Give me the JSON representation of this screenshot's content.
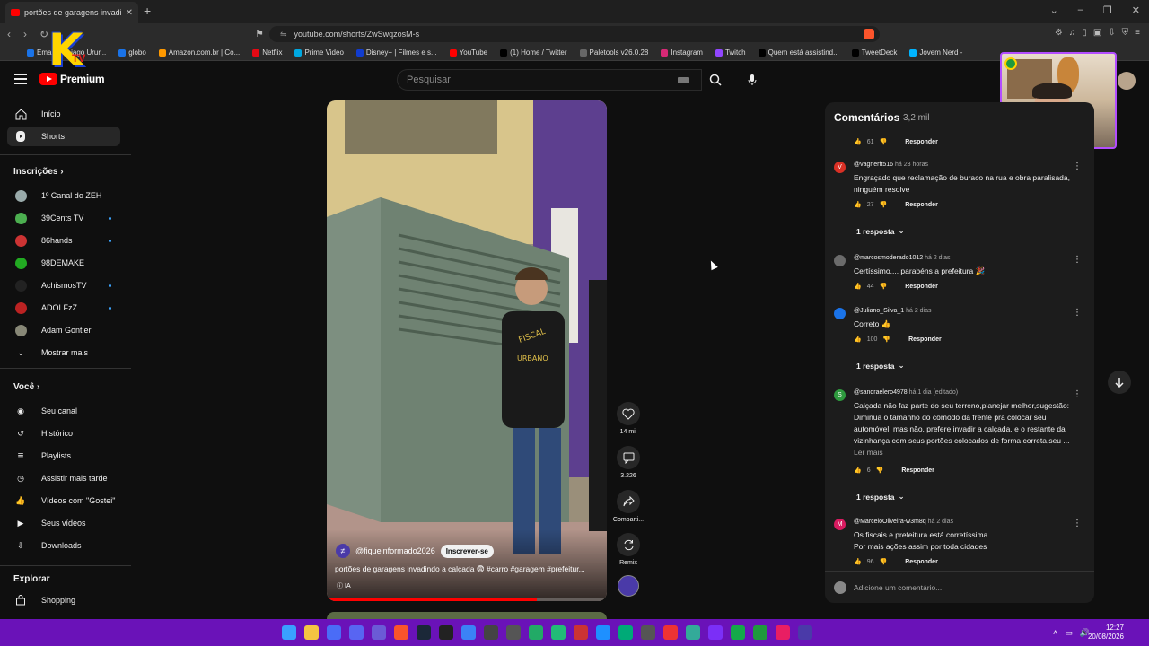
{
  "browser": {
    "tab_title": "portões de garagens invadind",
    "url": "youtube.com/shorts/ZwSwqzosM-s",
    "bookmarks": [
      {
        "label": "Email – Thiago Urur...",
        "color": "#1a73e8"
      },
      {
        "label": "globo",
        "color": "#1a73e8"
      },
      {
        "label": "Amazon.com.br | Co...",
        "color": "#ff9900"
      },
      {
        "label": "Netflix",
        "color": "#e50914"
      },
      {
        "label": "Prime Video",
        "color": "#00a8e1"
      },
      {
        "label": "Disney+ | Filmes e s...",
        "color": "#113ccf"
      },
      {
        "label": "YouTube",
        "color": "#ff0000"
      },
      {
        "label": "(1) Home / Twitter",
        "color": "#000000"
      },
      {
        "label": "Paletools v26.0.28",
        "color": "#666666"
      },
      {
        "label": "Instagram",
        "color": "#d62976"
      },
      {
        "label": "Twitch",
        "color": "#9146ff"
      },
      {
        "label": "Quem está assistind...",
        "color": "#000000"
      },
      {
        "label": "TweetDeck",
        "color": "#000000"
      },
      {
        "label": "Jovem Nerd -",
        "color": "#00b4ff"
      }
    ]
  },
  "header": {
    "logo_text": "Premium",
    "search_placeholder": "Pesquisar"
  },
  "sidebar": {
    "main": [
      {
        "label": "Início",
        "icon": "home-icon"
      },
      {
        "label": "Shorts",
        "icon": "shorts-icon"
      }
    ],
    "subscriptions_title": "Inscrições",
    "subscriptions": [
      {
        "label": "1º Canal do ZEH",
        "color": "#9aa",
        "live": false
      },
      {
        "label": "39Cents TV",
        "color": "#4caf50",
        "live": true
      },
      {
        "label": "86hands",
        "color": "#c33",
        "live": true
      },
      {
        "label": "98DEMAKE",
        "color": "#2a2",
        "live": false
      },
      {
        "label": "AchismosTV",
        "color": "#222",
        "live": true
      },
      {
        "label": "ADOLFzZ",
        "color": "#b22",
        "live": true
      },
      {
        "label": "Adam Gontier",
        "color": "#887",
        "live": false
      }
    ],
    "show_more": "Mostrar mais",
    "you_title": "Você",
    "you_items": [
      {
        "label": "Seu canal",
        "icon": "channel-icon"
      },
      {
        "label": "Histórico",
        "icon": "history-icon"
      },
      {
        "label": "Playlists",
        "icon": "playlist-icon"
      },
      {
        "label": "Assistir mais tarde",
        "icon": "watch-later-icon"
      },
      {
        "label": "Vídeos com \"Gostei\"",
        "icon": "like-icon"
      },
      {
        "label": "Seus vídeos",
        "icon": "your-videos-icon"
      },
      {
        "label": "Downloads",
        "icon": "download-icon"
      }
    ],
    "explore_title": "Explorar",
    "explore_items": [
      {
        "label": "Shopping",
        "icon": "shopping-icon"
      }
    ]
  },
  "short": {
    "channel": "@fiqueinformado2026",
    "subscribe_label": "Inscrever-se",
    "caption": "portões de garagens invadindo a calçada 😨 #carro #garagem #prefeitur...",
    "ia_label": "IA",
    "progress": 0.75,
    "actions": {
      "likes": "14 mil",
      "comments": "3.226",
      "share": "Comparti...",
      "remix": "Remix"
    }
  },
  "comments": {
    "title": "Comentários",
    "count": "3,2 mil",
    "reply_label": "Responder",
    "top_likes": "61",
    "items": [
      {
        "user": "@vagnerft516",
        "when": "há 23 horas",
        "initial": "V",
        "color": "#d93025",
        "text": "Engraçado que reclamação de buraco na rua e obra paralisada, ninguém resolve",
        "likes": "27",
        "replies": "1 resposta"
      },
      {
        "user": "@marcosmoderado1012",
        "when": "há 2 dias",
        "initial": "",
        "color": "#6b6b6b",
        "text": "Certíssimo.... parabéns a prefeitura 🎉",
        "likes": "44",
        "replies": ""
      },
      {
        "user": "@Juliano_Silva_1",
        "when": "há 2 dias",
        "initial": "",
        "color": "#1a73e8",
        "text": "Correto 👍",
        "likes": "100",
        "replies": "1 resposta"
      },
      {
        "user": "@sandraelero4978",
        "when": "há 1 dia (editado)",
        "initial": "S",
        "color": "#2e9a3e",
        "text": "Calçada  não  faz parte do seu terreno,planejar melhor,sugestão: Diminua o tamanho do cômodo  da frente pra colocar seu automóvel, mas não, prefere invadir a calçada, e o  restante da vizinhança com seus portões  colocados de forma correta,seu ...",
        "likes": "6",
        "replies": "1 resposta",
        "read_more": "Ler mais"
      },
      {
        "user": "@MarceloOliveira-w3m8q",
        "when": "há 2 dias",
        "initial": "M",
        "color": "#d81b60",
        "text": "Os fiscais e prefeitura está corretíssima\nPor mais ações assim por toda cidades",
        "likes": "96",
        "replies": ""
      }
    ],
    "add_placeholder": "Adicione um comentário..."
  },
  "taskbar": {
    "time": "12:27",
    "date": "20/08/2026"
  }
}
